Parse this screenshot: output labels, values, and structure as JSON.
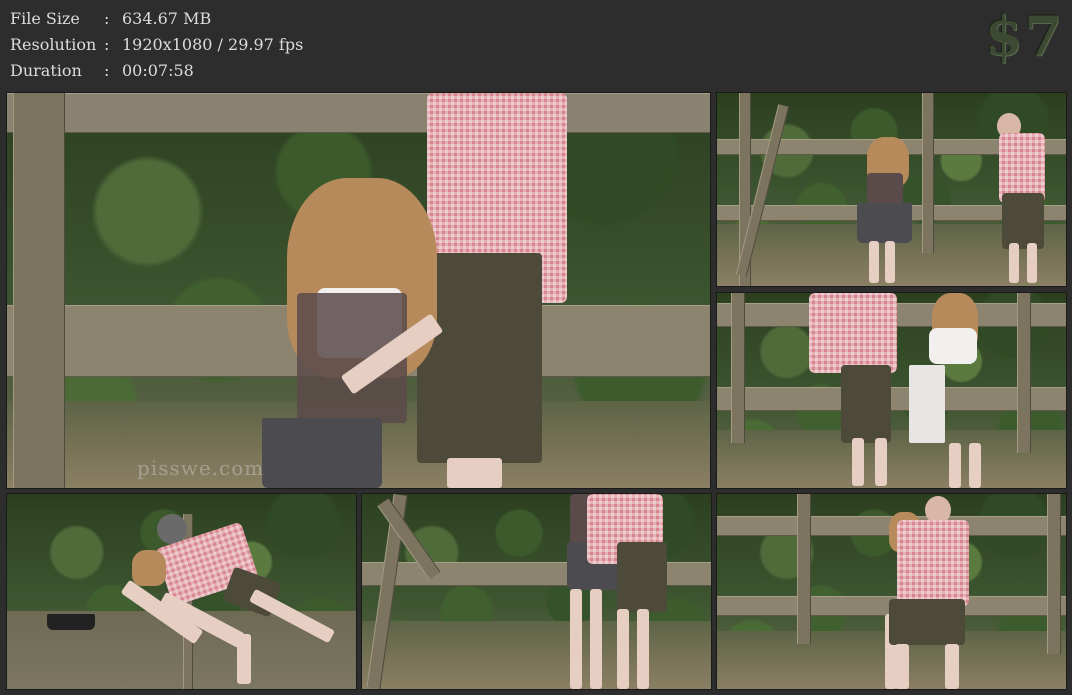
{
  "info": {
    "file_size": {
      "label": "File Size",
      "sep": ":",
      "value": "634.67 MB"
    },
    "resolution": {
      "label": "Resolution",
      "sep": ":",
      "value": "1920x1080 / 29.97 fps"
    },
    "duration": {
      "label": "Duration",
      "sep": ":",
      "value": "00:07:58"
    }
  },
  "price": "$7",
  "watermark": "pisswe.com",
  "colors": {
    "background": "#2d2d2d",
    "text": "#dcdcdc",
    "price": "#3c4a34"
  }
}
